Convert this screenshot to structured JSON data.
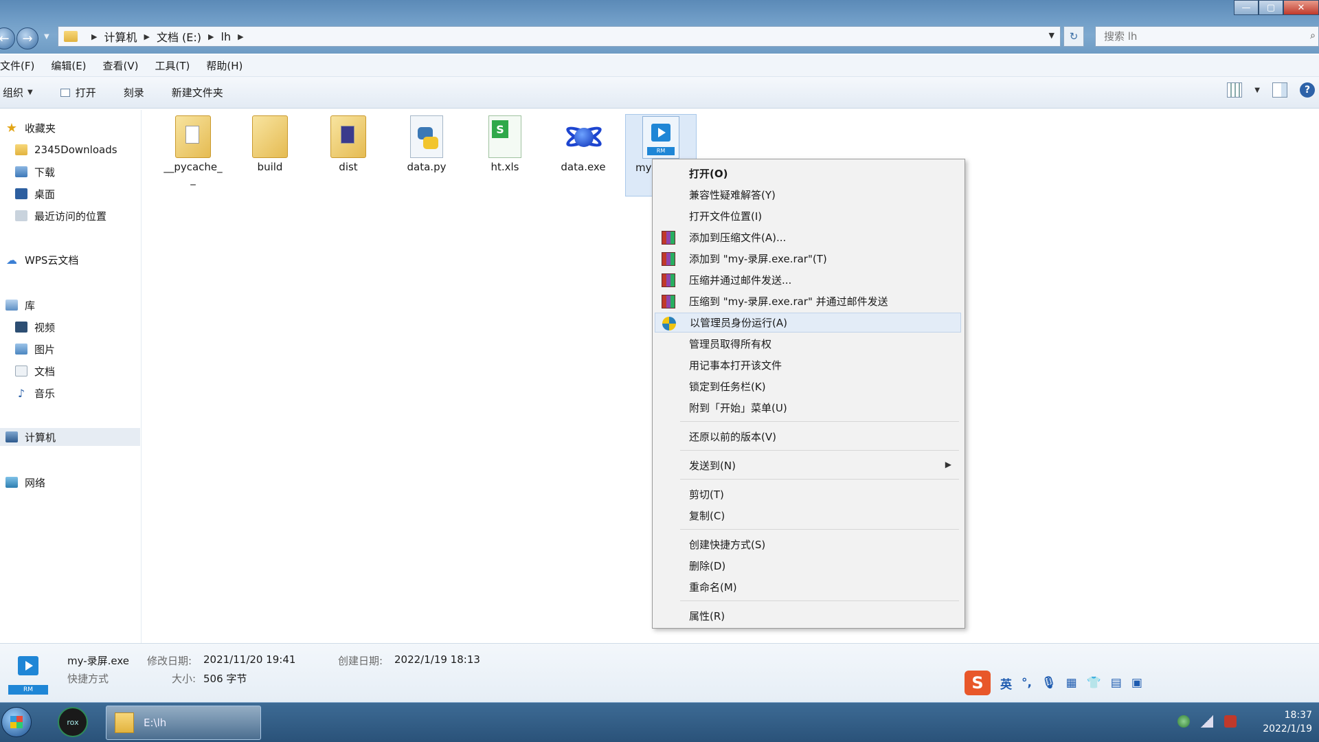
{
  "address": {
    "breadcrumbs": [
      "计算机",
      "文档 (E:)",
      "lh"
    ],
    "search_placeholder": "搜索 lh"
  },
  "window_controls": {
    "minimize": "—",
    "maximize": "▢",
    "close": "✕"
  },
  "menubar": [
    "文件(F)",
    "编辑(E)",
    "查看(V)",
    "工具(T)",
    "帮助(H)"
  ],
  "toolbar": {
    "organize": "组织",
    "open": "打开",
    "burn": "刻录",
    "new_folder": "新建文件夹"
  },
  "sidebar": {
    "favorites": "收藏夹",
    "downloads2345": "2345Downloads",
    "download": "下载",
    "desktop": "桌面",
    "recent": "最近访问的位置",
    "wps": "WPS云文档",
    "library": "库",
    "video": "视频",
    "pictures": "图片",
    "documents": "文档",
    "music": "音乐",
    "computer": "计算机",
    "network": "网络"
  },
  "files": [
    {
      "name": "__pycache_",
      "name2": "_",
      "type": "folder"
    },
    {
      "name": "build",
      "type": "folder"
    },
    {
      "name": "dist",
      "type": "folder"
    },
    {
      "name": "data.py",
      "type": "python"
    },
    {
      "name": "ht.xls",
      "type": "excel"
    },
    {
      "name": "data.exe",
      "type": "exe"
    },
    {
      "name": "my",
      "type": "shortcut"
    }
  ],
  "context_menu": [
    {
      "label": "打开(O)"
    },
    {
      "label": "兼容性疑难解答(Y)"
    },
    {
      "label": "打开文件位置(I)"
    },
    {
      "label": "添加到压缩文件(A)..."
    },
    {
      "label": "添加到 \"my-录屏.exe.rar\"(T)"
    },
    {
      "label": "压缩并通过邮件发送..."
    },
    {
      "label": "压缩到 \"my-录屏.exe.rar\" 并通过邮件发送"
    },
    {
      "label": "以管理员身份运行(A)"
    },
    {
      "label": "管理员取得所有权"
    },
    {
      "label": "用记事本打开该文件"
    },
    {
      "label": "锁定到任务栏(K)"
    },
    {
      "label": "附到「开始」菜单(U)"
    },
    {
      "label": "还原以前的版本(V)"
    },
    {
      "label": "发送到(N)"
    },
    {
      "label": "剪切(T)"
    },
    {
      "label": "复制(C)"
    },
    {
      "label": "创建快捷方式(S)"
    },
    {
      "label": "删除(D)"
    },
    {
      "label": "重命名(M)"
    },
    {
      "label": "属性(R)"
    }
  ],
  "details": {
    "filename": "my-录屏.exe",
    "type": "快捷方式",
    "modified_label": "修改日期:",
    "modified_value": "2021/11/20 19:41",
    "size_label": "大小:",
    "size_value": "506 字节",
    "created_label": "创建日期:",
    "created_value": "2022/1/19 18:13",
    "icon_tag": "RM"
  },
  "ime": {
    "logo": "S",
    "lang": "英"
  },
  "taskbar": {
    "app_label": "rox",
    "explorer_label": "E:\\lh",
    "time": "18:37",
    "date": "2022/1/19"
  }
}
